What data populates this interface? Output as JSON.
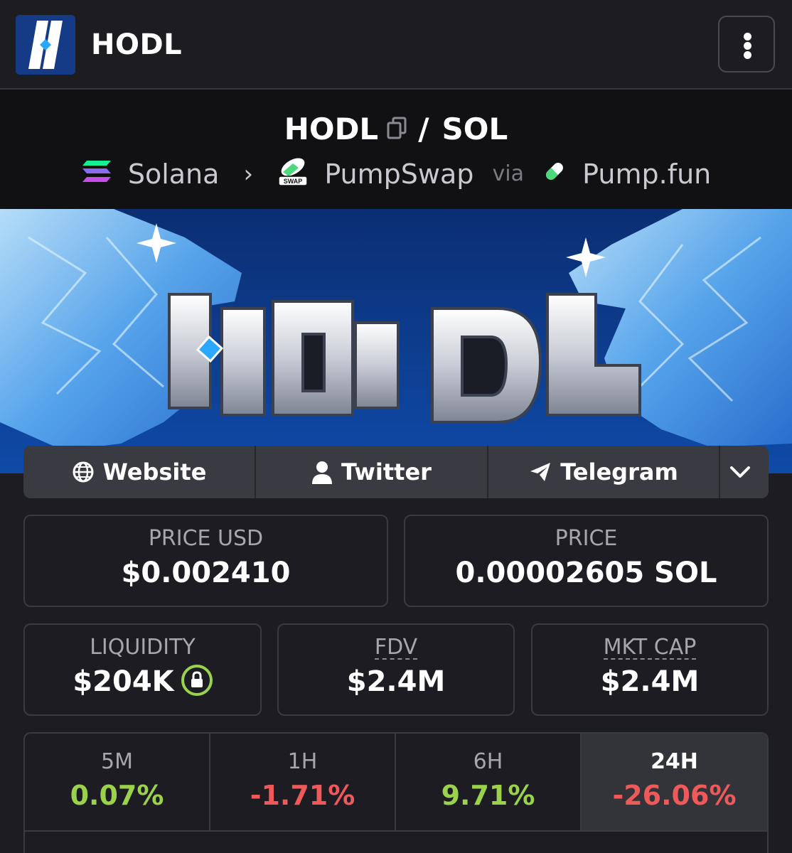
{
  "app": {
    "title": "HODL",
    "logo_icon": "hodl-logo-icon",
    "menu_icon": "vertical-dots-icon"
  },
  "pair": {
    "base": "HODL",
    "separator": "/",
    "quote": "SOL",
    "copy_icon": "copy-icon"
  },
  "route": {
    "chain": "Solana",
    "dex": "PumpSwap",
    "via": "via",
    "launchpad": "Pump.fun"
  },
  "banner": {
    "text": "HODL"
  },
  "links": [
    {
      "label": "Website",
      "icon": "globe-icon"
    },
    {
      "label": "Twitter",
      "icon": "user-icon"
    },
    {
      "label": "Telegram",
      "icon": "paper-plane-icon"
    }
  ],
  "stats": {
    "price_usd": {
      "label": "PRICE USD",
      "value": "$0.002410"
    },
    "price": {
      "label": "PRICE",
      "value": "0.00002605 SOL"
    },
    "liquidity": {
      "label": "LIQUIDITY",
      "value": "$204K"
    },
    "fdv": {
      "label": "FDV",
      "value": "$2.4M"
    },
    "mkt_cap": {
      "label": "MKT CAP",
      "value": "$2.4M"
    }
  },
  "timeframes": [
    {
      "label": "5M",
      "change": "0.07%",
      "trend": "up"
    },
    {
      "label": "1H",
      "change": "-1.71%",
      "trend": "down"
    },
    {
      "label": "6H",
      "change": "9.71%",
      "trend": "up"
    },
    {
      "label": "24H",
      "change": "-26.06%",
      "trend": "down",
      "active": true
    }
  ],
  "colors": {
    "positive": "#9bd24b",
    "negative": "#ee5a5a",
    "banner_bg": "#0f3a86"
  }
}
